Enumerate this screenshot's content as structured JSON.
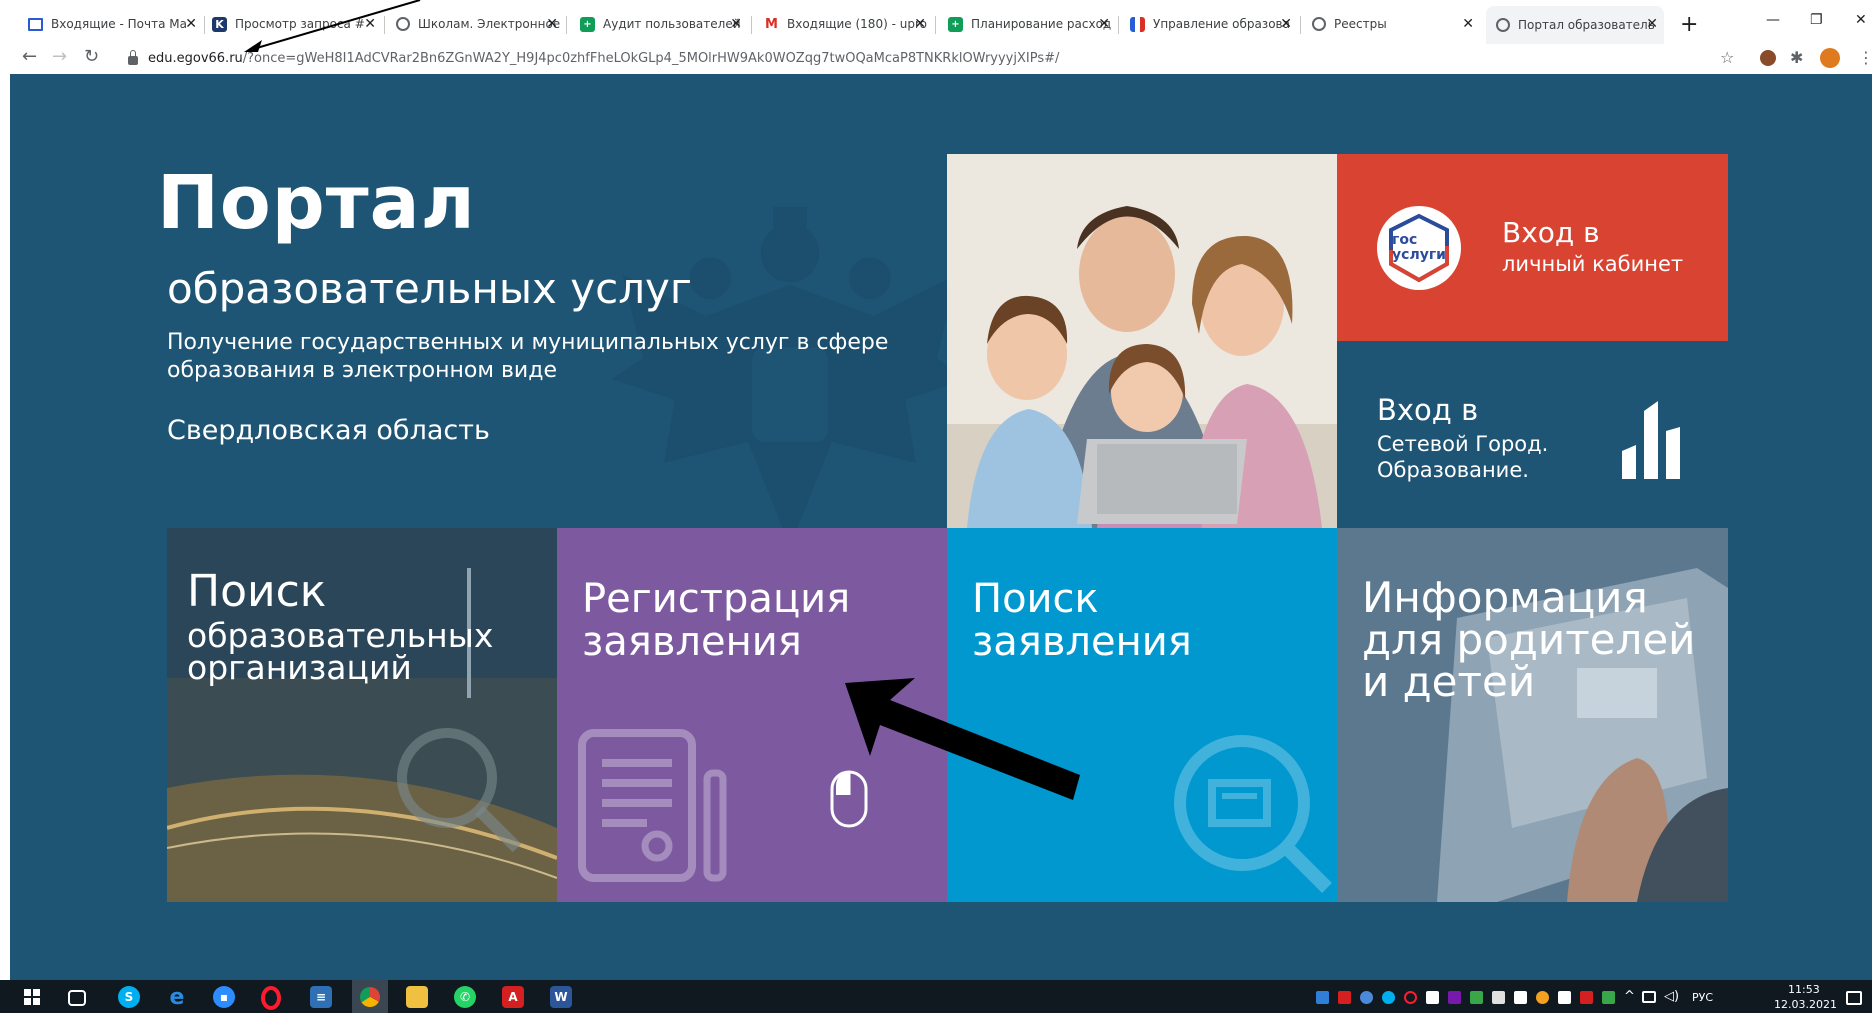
{
  "browser": {
    "tabs": [
      {
        "title": "Входящие - Почта Ма",
        "icon": "mail-icon",
        "color": "#2a5bd7"
      },
      {
        "title": "Просмотр запроса #",
        "icon": "k-icon",
        "color": "#1b3a6b"
      },
      {
        "title": "Школам. Электронное",
        "icon": "globe-icon",
        "color": "#5f6368"
      },
      {
        "title": "Аудит пользователей",
        "icon": "sheets-icon",
        "color": "#0f9d58"
      },
      {
        "title": "Входящие (180) - upro",
        "icon": "gmail-icon",
        "color": "#d93025"
      },
      {
        "title": "Планирование расход",
        "icon": "sheets-icon",
        "color": "#0f9d58"
      },
      {
        "title": "Управление образова",
        "icon": "flag-icon",
        "color": "#2a5bd7"
      },
      {
        "title": "Реестры",
        "icon": "globe-icon",
        "color": "#5f6368"
      },
      {
        "title": "Портал образователь",
        "icon": "globe-icon",
        "color": "#5f6368",
        "active": true
      }
    ],
    "url_host": "edu.egov66.ru",
    "url_rest": "/?once=gWeH8I1AdCVRar2Bn6ZGnWA2Y_H9J4pc0zhfFheLOkGLp4_5MOlrHW9Ak0WOZqg7twOQaMcaP8TNKRklOWryyyjXIPs#/"
  },
  "hero": {
    "title": "Портал",
    "subtitle": "образовательных услуг",
    "description": "Получение государственных и муниципальных услуг в сфере образования в электронном виде",
    "region": "Свердловская область"
  },
  "gosuslugi": {
    "logo_line1": "гос",
    "logo_line2": "услуги",
    "line1": "Вход в",
    "line2": "личный кабинет",
    "color": "#d94332"
  },
  "netcity": {
    "line1": "Вход в",
    "line2": "Сетевой Город.",
    "line3": "Образование."
  },
  "tiles": {
    "search_org": {
      "line1": "Поиск",
      "line2": "образовательных",
      "line3": "организаций"
    },
    "register": {
      "line1": "Регистрация",
      "line2": "заявления",
      "color": "#7d5aa0"
    },
    "search_app": {
      "line1": "Поиск",
      "line2": "заявления",
      "color": "#0098cf"
    },
    "info": {
      "line1": "Информация",
      "line2": "для родителей",
      "line3": "и детей"
    }
  },
  "taskbar": {
    "lang": "РУС",
    "time": "11:53",
    "date": "12.03.2021"
  },
  "colors": {
    "page_bg": "#1f5574",
    "annotation_arrow": "#000000"
  }
}
